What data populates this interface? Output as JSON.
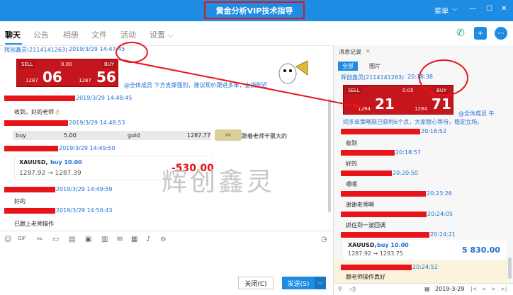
{
  "window": {
    "title": "黄金分析VIP技术指导",
    "menu_label": "菜单",
    "minimize": "—",
    "maximize": "☐",
    "close": "✕"
  },
  "tabs": [
    "聊天",
    "公告",
    "相册",
    "文件",
    "活动",
    "设置 ⌵"
  ],
  "chat": {
    "sender": "辉创鑫灵(2114141263)",
    "first_time": "2019/3/29 14:47:45",
    "quote": {
      "sell": "SELL",
      "buy": "BUY",
      "lot": "0.00",
      "sell_small": "1287",
      "sell_big": "06",
      "buy_small": "1287",
      "buy_big": "56"
    },
    "announce": "@全体成员  下方支撑强烈，建议现价跟进多单，止损附近",
    "messages": [
      {
        "time": "2019/3/29 14:48:45",
        "text": "收到，好的老师👌🏻"
      },
      {
        "time": "2019/3/29 14:48:53",
        "text": ""
      },
      {
        "time": "2019/3/29 14:49:50",
        "text": ""
      },
      {
        "time": "2019/3/29 14:49:59",
        "text": "好的"
      },
      {
        "time": "2019/3/29 14:50:43",
        "text": "已跟上老师操作"
      }
    ],
    "trade_row": {
      "side": "buy",
      "lot": "5.00",
      "symbol": "gold",
      "price": "1287.77",
      "text": "跟着老师干票大的"
    },
    "trade_card": {
      "symbol": "XAUUSD,",
      "action": "buy 10.00",
      "from_to": "1287.92 → 1287.39",
      "pnl": "-530.00"
    }
  },
  "buttons": {
    "close": "关闭(C)",
    "send": "发送(S)",
    "send_arrow": "⌵"
  },
  "right": {
    "title": "消息记录",
    "close": "✕",
    "tab_all": "全部",
    "tab_images": "图片",
    "sender": "辉创鑫灵(2114141263)",
    "first_time": "20:18:38",
    "quote": {
      "sell": "SELL",
      "buy": "BUY",
      "lot": "0.05",
      "sell_small": "1294",
      "sell_big": "21",
      "buy_small": "1294",
      "buy_big": "71"
    },
    "announce_1": "@全体成员 午",
    "announce_2": "间多单策略现已获利6个点，大家耐心等待，稳定立场。",
    "messages": [
      {
        "time": "20:18:52",
        "text": "收到"
      },
      {
        "time": "20:18:57",
        "text": "好的"
      },
      {
        "time": "20:20:50",
        "text": "嗯嗯"
      },
      {
        "time": "20:23:26",
        "text": "谢谢老师啊"
      },
      {
        "time": "20:24:05",
        "text": "抓住到一波回调"
      },
      {
        "time": "20:24:21",
        "text": ""
      },
      {
        "time": "20:24:52",
        "text": "跟老师操作真好"
      }
    ],
    "trade_card": {
      "symbol": "XAUUSD,",
      "action": "buy 10.00",
      "from_to": "1287.92 → 1293.75",
      "pnl": "5 830.00"
    },
    "date": "2019-3-29"
  },
  "watermark": "辉创鑫灵",
  "colors": {
    "primary": "#1e8ce3",
    "highlight": "#e7141a",
    "quote_bg": "#c4161c"
  }
}
